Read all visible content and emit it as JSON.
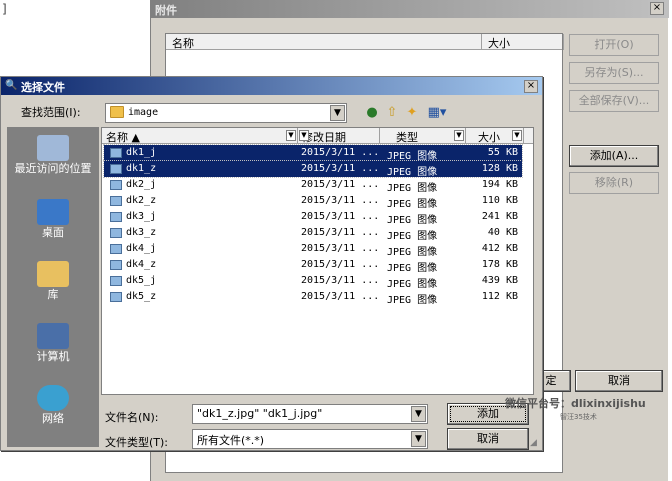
{
  "background_window": {
    "title": "附件",
    "close": "×",
    "edge_text": "]",
    "columns": [
      "名称",
      "大小"
    ],
    "buttons": [
      "打开(O)",
      "另存为(S)...",
      "全部保存(V)...",
      "添加(A)...",
      "移除(R)"
    ],
    "lower_left_fragment": "定",
    "cancel": "取消"
  },
  "dialog": {
    "title": "选择文件",
    "close": "×",
    "look_in_label": "查找范围(I):",
    "look_in_value": "image",
    "places": [
      {
        "label": "最近访问的位置",
        "icon": "recent-places-icon"
      },
      {
        "label": "桌面",
        "icon": "desktop-icon"
      },
      {
        "label": "库",
        "icon": "library-icon"
      },
      {
        "label": "计算机",
        "icon": "computer-icon"
      },
      {
        "label": "网络",
        "icon": "network-icon"
      }
    ],
    "columns": [
      "名称",
      "修改日期",
      "类型",
      "大小"
    ],
    "files": [
      {
        "name": "dk1_j",
        "date": "2015/3/11 ...",
        "type": "JPEG 图像",
        "size": "55 KB",
        "selected": true
      },
      {
        "name": "dk1_z",
        "date": "2015/3/11 ...",
        "type": "JPEG 图像",
        "size": "128 KB",
        "selected": true
      },
      {
        "name": "dk2_j",
        "date": "2015/3/11 ...",
        "type": "JPEG 图像",
        "size": "194 KB",
        "selected": false
      },
      {
        "name": "dk2_z",
        "date": "2015/3/11 ...",
        "type": "JPEG 图像",
        "size": "110 KB",
        "selected": false
      },
      {
        "name": "dk3_j",
        "date": "2015/3/11 ...",
        "type": "JPEG 图像",
        "size": "241 KB",
        "selected": false
      },
      {
        "name": "dk3_z",
        "date": "2015/3/11 ...",
        "type": "JPEG 图像",
        "size": "40 KB",
        "selected": false
      },
      {
        "name": "dk4_j",
        "date": "2015/3/11 ...",
        "type": "JPEG 图像",
        "size": "412 KB",
        "selected": false
      },
      {
        "name": "dk4_z",
        "date": "2015/3/11 ...",
        "type": "JPEG 图像",
        "size": "178 KB",
        "selected": false
      },
      {
        "name": "dk5_j",
        "date": "2015/3/11 ...",
        "type": "JPEG 图像",
        "size": "439 KB",
        "selected": false
      },
      {
        "name": "dk5_z",
        "date": "2015/3/11 ...",
        "type": "JPEG 图像",
        "size": "112 KB",
        "selected": false
      }
    ],
    "filename_label": "文件名(N):",
    "filename_value": "\"dk1_z.jpg\" \"dk1_j.jpg\"",
    "filetype_label": "文件类型(T):",
    "filetype_value": "所有文件(*.*)",
    "add_button": "添加",
    "cancel_button": "取消"
  },
  "watermark": {
    "text": "微信平台号：dlixinxijishu",
    "sub": "智汪35技术"
  }
}
